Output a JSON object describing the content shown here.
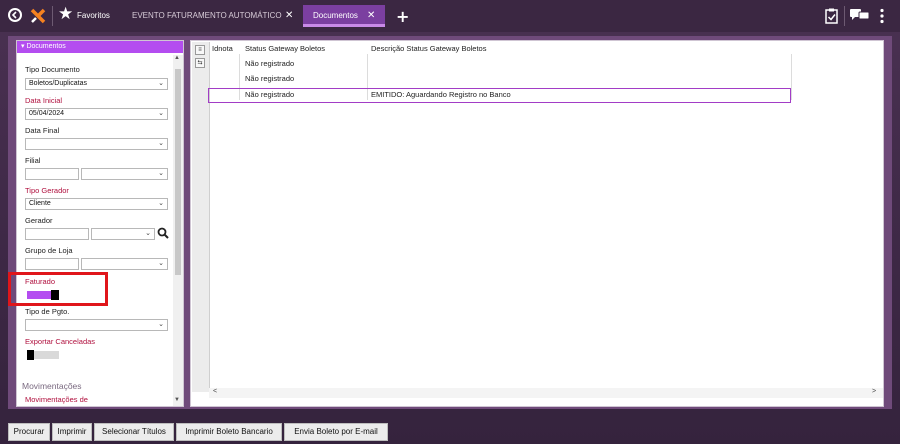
{
  "tabs": {
    "favoritos": "Favoritos",
    "tab1": "EVENTO FATURAMENTO AUTOMÁTICO",
    "tab2": "Documentos",
    "close": "✕",
    "add": "+"
  },
  "colors": {
    "accent": "#b44df0",
    "header": "#3b2742",
    "required": "#b0103e",
    "highlight": "#e0161b"
  },
  "panel": {
    "title": "Documentos",
    "tipo_documento": {
      "label": "Tipo Documento",
      "value": "Boletos/Duplicatas"
    },
    "data_inicial": {
      "label": "Data Inicial",
      "value": "05/04/2024"
    },
    "data_final": {
      "label": "Data Final",
      "value": ""
    },
    "filial": {
      "label": "Filial"
    },
    "tipo_gerador": {
      "label": "Tipo Gerador",
      "value": "Cliente"
    },
    "gerador": {
      "label": "Gerador"
    },
    "grupo_de_loja": {
      "label": "Grupo de Loja"
    },
    "faturado": {
      "label": "Faturado",
      "on": true
    },
    "tipo_pgto": {
      "label": "Tipo de Pgto."
    },
    "exportar_canceladas": {
      "label": "Exportar Canceladas",
      "on": false
    },
    "section": "Movimentações",
    "movimentacoes_de": {
      "label": "Movimentações de"
    }
  },
  "grid": {
    "columns": [
      "Idnota",
      "Status Gateway Boletos",
      "Descrição Status Gateway Boletos"
    ],
    "rows": [
      {
        "idnota": "",
        "status": "Não registrado",
        "descricao": ""
      },
      {
        "idnota": "",
        "status": "Não registrado",
        "descricao": ""
      },
      {
        "idnota": "",
        "status": "Não registrado",
        "descricao": "EMITIDO: Aguardando Registro no Banco"
      }
    ],
    "selected_row": 2
  },
  "actions": {
    "procurar": "Procurar",
    "imprimir": "Imprimir",
    "selecionar_titulos": "Selecionar Títulos",
    "imprimir_boleto": "Imprimir Boleto Bancario",
    "envia_boleto": "Envia Boleto por E-mail"
  }
}
